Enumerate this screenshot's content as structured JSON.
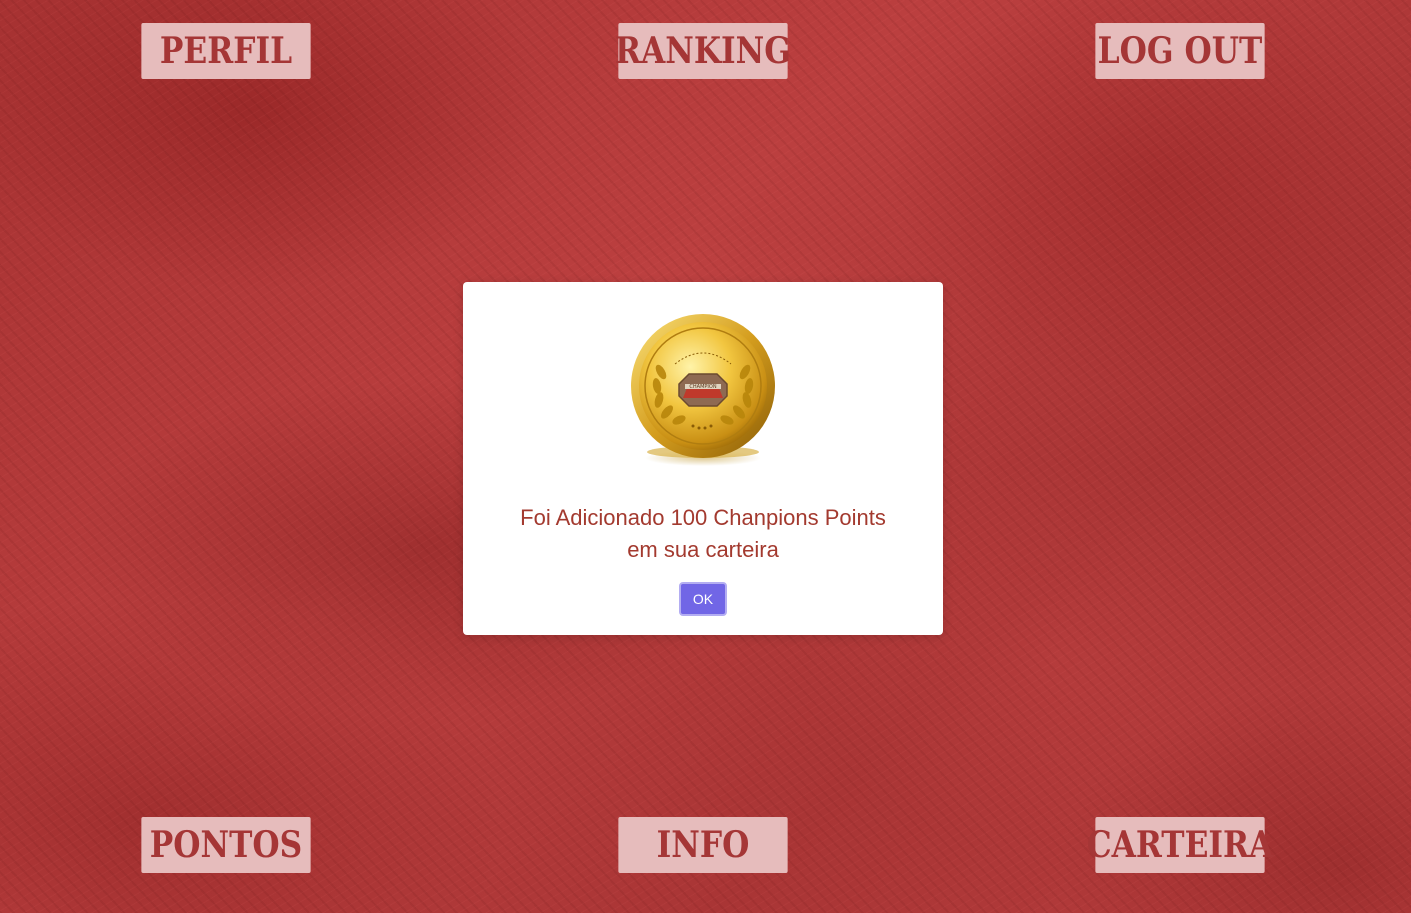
{
  "nav": {
    "top": {
      "perfil": "PERFIL",
      "ranking": "RANKING",
      "logout": "LOG OUT"
    },
    "bottom": {
      "pontos": "PONTOS",
      "info": "INFO",
      "carteira": "CARTEIRA"
    }
  },
  "modal": {
    "message_line1": "Foi Adicionado 100 Chanpions Points",
    "message_line2": "em sua carteira",
    "ok_label": "OK",
    "coin_icon": "gold-coin-icon",
    "coin_text": "CHAMPION"
  },
  "colors": {
    "background": "#b33a3a",
    "nav_button_bg": "#e6bcbc",
    "nav_button_text": "#a53636",
    "modal_text": "#a33a2f",
    "ok_button": "#7166e6",
    "coin_gold": "#e0b12a"
  }
}
